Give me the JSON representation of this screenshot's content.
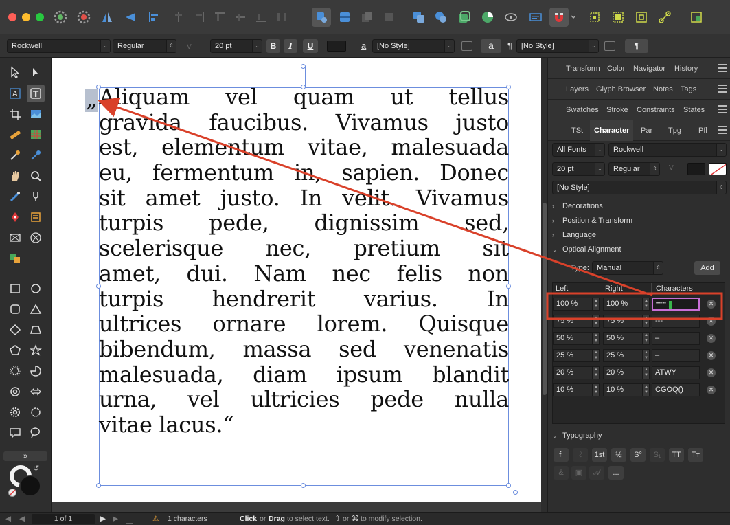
{
  "toolbar": {
    "icons": [
      "persona-designer-icon",
      "persona-pixel-icon",
      "persona-export-icon",
      "persona-shared-icon",
      "align-icon",
      "distribute-icon",
      "snap-icon",
      "color-icon"
    ]
  },
  "contextbar": {
    "font_family": "Rockwell",
    "font_style": "Regular",
    "font_size": "20 pt",
    "bold": "B",
    "italic": "I",
    "underline": "U",
    "char_style": "[No Style]",
    "para_style_label": "¶",
    "para_style": "[No Style]",
    "a_label": "a",
    "a_small": "a",
    "pilcrow": "¶"
  },
  "document": {
    "lines": [
      "Aliquam vel quam ut tellus",
      "gravida faucibus. Vivamus justo",
      "est, elementum vitae, malesuada",
      "eu, fermentum in, sapien. Donec",
      "sit amet justo. In velit. Vivamus",
      "turpis pede, dignissim sed,",
      "scelerisque nec, pretium sit",
      "amet, dui. Nam nec felis non",
      "turpis hendrerit varius. In",
      "ultrices ornare lorem. Quisque",
      "bibendum, massa sed venenatis",
      "malesuada, diam ipsum blandit",
      "urna, vel ultricies pede nulla",
      "vitae lacus.“"
    ],
    "opening_quote": "„"
  },
  "panel": {
    "row1_tabs": [
      "Transform",
      "Color",
      "Navigator",
      "History"
    ],
    "row2_tabs": [
      "Layers",
      "Glyph Browser",
      "Notes",
      "Tags"
    ],
    "row3_tabs": [
      "Swatches",
      "Stroke",
      "Constraints",
      "States"
    ],
    "row4_tabs": [
      "TSt",
      "Character",
      "Par",
      "Tpg",
      "Pfl"
    ],
    "font_collection": "All Fonts",
    "font_family": "Rockwell",
    "font_size": "20 pt",
    "font_style": "Regular",
    "char_style": "[No Style]",
    "sections": [
      "Decorations",
      "Position & Transform",
      "Language",
      "Optical Alignment"
    ],
    "oa_type_label": "Type:",
    "oa_type_value": "Manual",
    "add_label": "Add",
    "col_left": "Left",
    "col_right": "Right",
    "col_chars": "Characters",
    "rows": [
      {
        "left": "100 %",
        "right": "100 %",
        "chars": "\"\"\"\"'''.,"
      },
      {
        "left": "75 %",
        "right": "75 %",
        "chars": "---"
      },
      {
        "left": "50 %",
        "right": "50 %",
        "chars": "–"
      },
      {
        "left": "25 %",
        "right": "25 %",
        "chars": "–"
      },
      {
        "left": "20 %",
        "right": "20 %",
        "chars": "ATWY"
      },
      {
        "left": "10 %",
        "right": "10 %",
        "chars": "CGOQ()"
      }
    ],
    "typography_label": "Typography",
    "typo_buttons": [
      "fi",
      "ℓ",
      "1st",
      "½",
      "S°",
      "S₁",
      "TT",
      "Tт"
    ],
    "more_label": "..."
  },
  "statusbar": {
    "page": "1 of 1",
    "selection": "1 characters",
    "hint_click": "Click",
    "hint_or": "or",
    "hint_drag": "Drag",
    "hint_rest": "to select text.",
    "hint_mod": "or",
    "hint_end": "to modify selection."
  },
  "colors": {
    "accent_red": "#d9412a",
    "selection_frame": "#6c8ede",
    "char_field_border": "#c86fd6"
  }
}
